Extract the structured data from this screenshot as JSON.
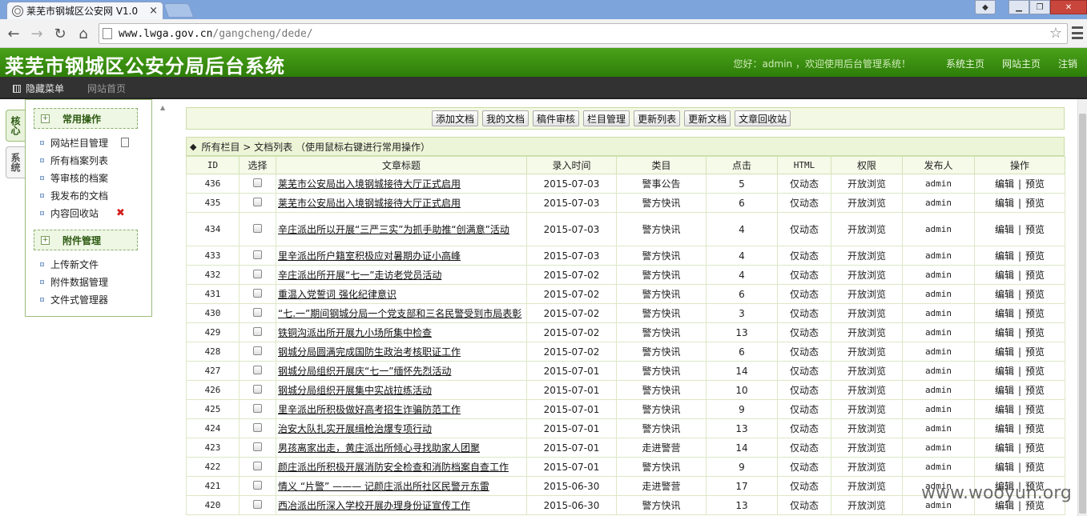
{
  "browser": {
    "tab_title": "莱芜市钢城区公安网 V1.0",
    "tab_close": "×",
    "url_host": "www.lwga.gov.cn",
    "url_path": "/gangcheng/dede/"
  },
  "header": {
    "title": "莱芜市钢城区公安分局后台系统",
    "greeting": "您好：admin ，欢迎使用后台管理系统！",
    "links": [
      "系统主页",
      "网站主页",
      "注销"
    ]
  },
  "menubar": {
    "hide_menu": "隐藏菜单",
    "site_home": "网站首页"
  },
  "sidebar": {
    "tabs": [
      "核心",
      "系统"
    ],
    "groups": [
      {
        "label": "常用操作",
        "items": [
          "网站栏目管理",
          "所有档案列表",
          "等审核的档案",
          "我发布的文档",
          "内容回收站"
        ]
      },
      {
        "label": "附件管理",
        "items": [
          "上传新文件",
          "附件数据管理",
          "文件式管理器"
        ]
      }
    ]
  },
  "actions": [
    "添加文档",
    "我的文档",
    "稿件审核",
    "栏目管理",
    "更新列表",
    "更新文档",
    "文章回收站"
  ],
  "list_title": "所有栏目 > 文档列表  （使用鼠标右键进行常用操作）",
  "table": {
    "headers": [
      "ID",
      "选择",
      "文章标题",
      "录入时间",
      "类目",
      "点击",
      "HTML",
      "权限",
      "发布人",
      "操作"
    ],
    "op_edit": "编辑",
    "op_sep": "|",
    "op_preview": "预览",
    "rows": [
      {
        "id": "436",
        "title": "莱芜市公安局出入境钢城接待大厅正式启用",
        "date": "2015-07-03",
        "category": "警事公告",
        "clicks": "5",
        "html": "仅动态",
        "permission": "开放浏览",
        "author": "admin"
      },
      {
        "id": "435",
        "title": "莱芜市公安局出入境钢城接待大厅正式启用",
        "date": "2015-07-03",
        "category": "警方快讯",
        "clicks": "6",
        "html": "仅动态",
        "permission": "开放浏览",
        "author": "admin"
      },
      {
        "id": "434",
        "title": "辛庄派出所以开展“三严三实”为抓手助推“创满意”活动",
        "date": "2015-07-03",
        "category": "警方快讯",
        "clicks": "4",
        "html": "仅动态",
        "permission": "开放浏览",
        "author": "admin",
        "tall": true
      },
      {
        "id": "433",
        "title": "里辛派出所户籍室积极应对暑期办证小高峰",
        "date": "2015-07-03",
        "category": "警方快讯",
        "clicks": "4",
        "html": "仅动态",
        "permission": "开放浏览",
        "author": "admin"
      },
      {
        "id": "432",
        "title": "辛庄派出所开展“七一”走访老党员活动",
        "date": "2015-07-02",
        "category": "警方快讯",
        "clicks": "4",
        "html": "仅动态",
        "permission": "开放浏览",
        "author": "admin"
      },
      {
        "id": "431",
        "title": "重温入党誓词 强化纪律意识",
        "date": "2015-07-02",
        "category": "警方快讯",
        "clicks": "6",
        "html": "仅动态",
        "permission": "开放浏览",
        "author": "admin"
      },
      {
        "id": "430",
        "title": "“七.一”期间钢城分局一个党支部和三名民警受到市局表彰",
        "date": "2015-07-02",
        "category": "警方快讯",
        "clicks": "3",
        "html": "仅动态",
        "permission": "开放浏览",
        "author": "admin"
      },
      {
        "id": "429",
        "title": "铁铜沟派出所开展九小场所集中检查",
        "date": "2015-07-02",
        "category": "警方快讯",
        "clicks": "13",
        "html": "仅动态",
        "permission": "开放浏览",
        "author": "admin"
      },
      {
        "id": "428",
        "title": "钢城分局圆满完成国防生政治考核职证工作",
        "date": "2015-07-02",
        "category": "警方快讯",
        "clicks": "6",
        "html": "仅动态",
        "permission": "开放浏览",
        "author": "admin"
      },
      {
        "id": "427",
        "title": "钢城分局组织开展庆“七一”缅怀先烈活动",
        "date": "2015-07-01",
        "category": "警方快讯",
        "clicks": "14",
        "html": "仅动态",
        "permission": "开放浏览",
        "author": "admin"
      },
      {
        "id": "426",
        "title": "钢城分局组织开展集中实战拉练活动",
        "date": "2015-07-01",
        "category": "警方快讯",
        "clicks": "10",
        "html": "仅动态",
        "permission": "开放浏览",
        "author": "admin"
      },
      {
        "id": "425",
        "title": "里辛派出所积极做好高考招生诈骗防范工作",
        "date": "2015-07-01",
        "category": "警方快讯",
        "clicks": "9",
        "html": "仅动态",
        "permission": "开放浏览",
        "author": "admin"
      },
      {
        "id": "424",
        "title": "治安大队扎实开展缉枪治爆专项行动",
        "date": "2015-07-01",
        "category": "警方快讯",
        "clicks": "13",
        "html": "仅动态",
        "permission": "开放浏览",
        "author": "admin"
      },
      {
        "id": "423",
        "title": "男孩离家出走，黄庄派出所倾心寻找助家人团聚",
        "date": "2015-07-01",
        "category": "走进警营",
        "clicks": "14",
        "html": "仅动态",
        "permission": "开放浏览",
        "author": "admin"
      },
      {
        "id": "422",
        "title": "颜庄派出所积极开展消防安全检查和消防档案自查工作",
        "date": "2015-07-01",
        "category": "警方快讯",
        "clicks": "9",
        "html": "仅动态",
        "permission": "开放浏览",
        "author": "admin"
      },
      {
        "id": "421",
        "title": "情义 “片警” ——— 记颜庄派出所社区民警亓东雷",
        "date": "2015-06-30",
        "category": "走进警营",
        "clicks": "17",
        "html": "仅动态",
        "permission": "开放浏览",
        "author": "admin"
      },
      {
        "id": "420",
        "title": "西冶派出所深入学校开展办理身份证宣传工作",
        "date": "2015-06-30",
        "category": "警方快讯",
        "clicks": "13",
        "html": "仅动态",
        "permission": "开放浏览",
        "author": "admin"
      }
    ]
  },
  "watermark": "www.wooyun.org"
}
